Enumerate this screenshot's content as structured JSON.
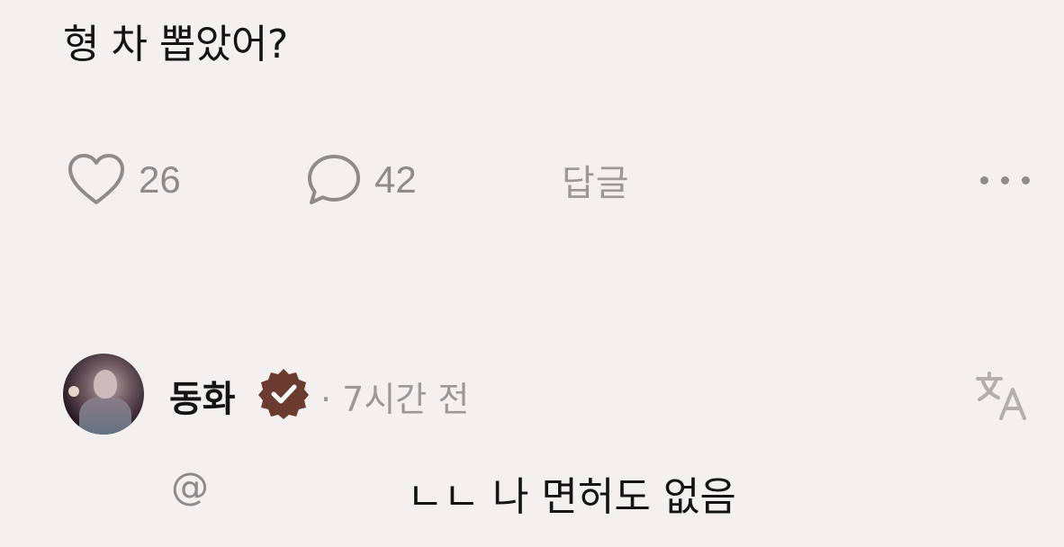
{
  "post": {
    "text": "형 차 뽑았어?"
  },
  "actions": {
    "likes": "26",
    "comments": "42",
    "reply_label": "답글"
  },
  "reply": {
    "author": "동화",
    "meta": "· 7시간 전",
    "mention": "@",
    "text": "ㄴㄴ 나 면허도 없음"
  },
  "icons": {
    "like": "heart-icon",
    "comment": "comment-bubble-icon",
    "more": "more-dots-icon",
    "verified": "verified-badge-icon",
    "translate": "translate-icon"
  },
  "colors": {
    "background": "#f3f0ef",
    "text": "#141414",
    "muted": "#8f8b8a",
    "verified_badge": "#6a3b2e"
  }
}
